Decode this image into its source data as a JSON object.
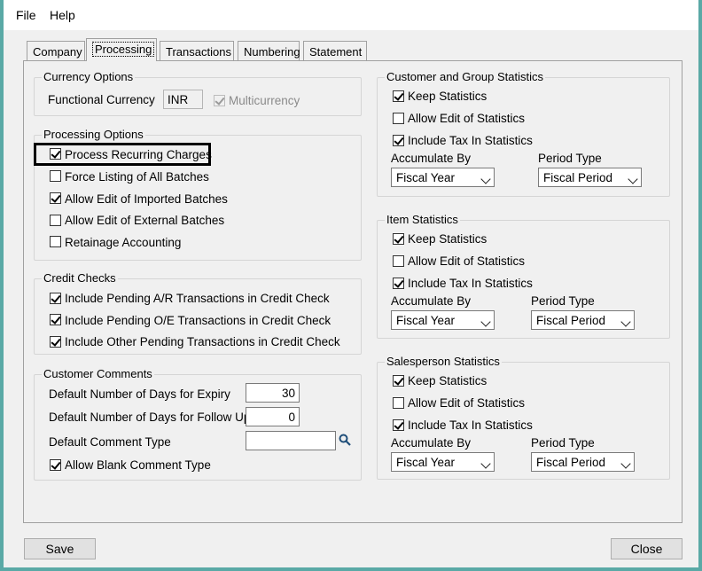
{
  "menu": {
    "file": "File",
    "help": "Help"
  },
  "tabs": [
    {
      "label": "Company"
    },
    {
      "label": "Processing"
    },
    {
      "label": "Transactions"
    },
    {
      "label": "Numbering"
    },
    {
      "label": "Statement"
    }
  ],
  "currency_options": {
    "title": "Currency Options",
    "functional_currency_label": "Functional Currency",
    "functional_currency_value": "INR",
    "multicurrency_label": "Multicurrency",
    "multicurrency_checked": true
  },
  "processing_options": {
    "title": "Processing Options",
    "items": [
      {
        "label": "Process Recurring Charges",
        "checked": true
      },
      {
        "label": "Force Listing of All Batches",
        "checked": false
      },
      {
        "label": "Allow Edit of Imported Batches",
        "checked": true
      },
      {
        "label": "Allow Edit of External Batches",
        "checked": false
      },
      {
        "label": "Retainage Accounting",
        "checked": false
      }
    ]
  },
  "credit_checks": {
    "title": "Credit Checks",
    "items": [
      {
        "label": "Include Pending A/R Transactions in Credit Check",
        "checked": true
      },
      {
        "label": "Include Pending O/E Transactions in Credit Check",
        "checked": true
      },
      {
        "label": "Include Other Pending Transactions in Credit Check",
        "checked": true
      }
    ]
  },
  "customer_comments": {
    "title": "Customer Comments",
    "expiry_label": "Default Number of Days for Expiry",
    "expiry_value": "30",
    "followup_label": "Default Number of Days for Follow Up",
    "followup_value": "0",
    "comment_type_label": "Default Comment Type",
    "comment_type_value": "",
    "allow_blank_label": "Allow Blank Comment Type",
    "allow_blank_checked": true
  },
  "customer_group_stats": {
    "title": "Customer and Group Statistics",
    "keep": "Keep Statistics",
    "allow_edit": "Allow Edit of Statistics",
    "include_tax": "Include Tax In Statistics",
    "accumulate_by_label": "Accumulate By",
    "accumulate_by_value": "Fiscal Year",
    "period_type_label": "Period Type",
    "period_type_value": "Fiscal Period"
  },
  "item_stats": {
    "title": "Item Statistics",
    "keep": "Keep Statistics",
    "allow_edit": "Allow Edit of Statistics",
    "include_tax": "Include Tax In Statistics",
    "accumulate_by_label": "Accumulate By",
    "accumulate_by_value": "Fiscal Year",
    "period_type_label": "Period Type",
    "period_type_value": "Fiscal Period"
  },
  "salesperson_stats": {
    "title": "Salesperson Statistics",
    "keep": "Keep Statistics",
    "allow_edit": "Allow Edit of Statistics",
    "include_tax": "Include Tax In Statistics",
    "accumulate_by_label": "Accumulate By",
    "accumulate_by_value": "Fiscal Year",
    "period_type_label": "Period Type",
    "period_type_value": "Fiscal Period"
  },
  "buttons": {
    "save": "Save",
    "close": "Close"
  },
  "colors": {
    "frame": "#5aa9a6",
    "highlight_border": "#000000"
  }
}
